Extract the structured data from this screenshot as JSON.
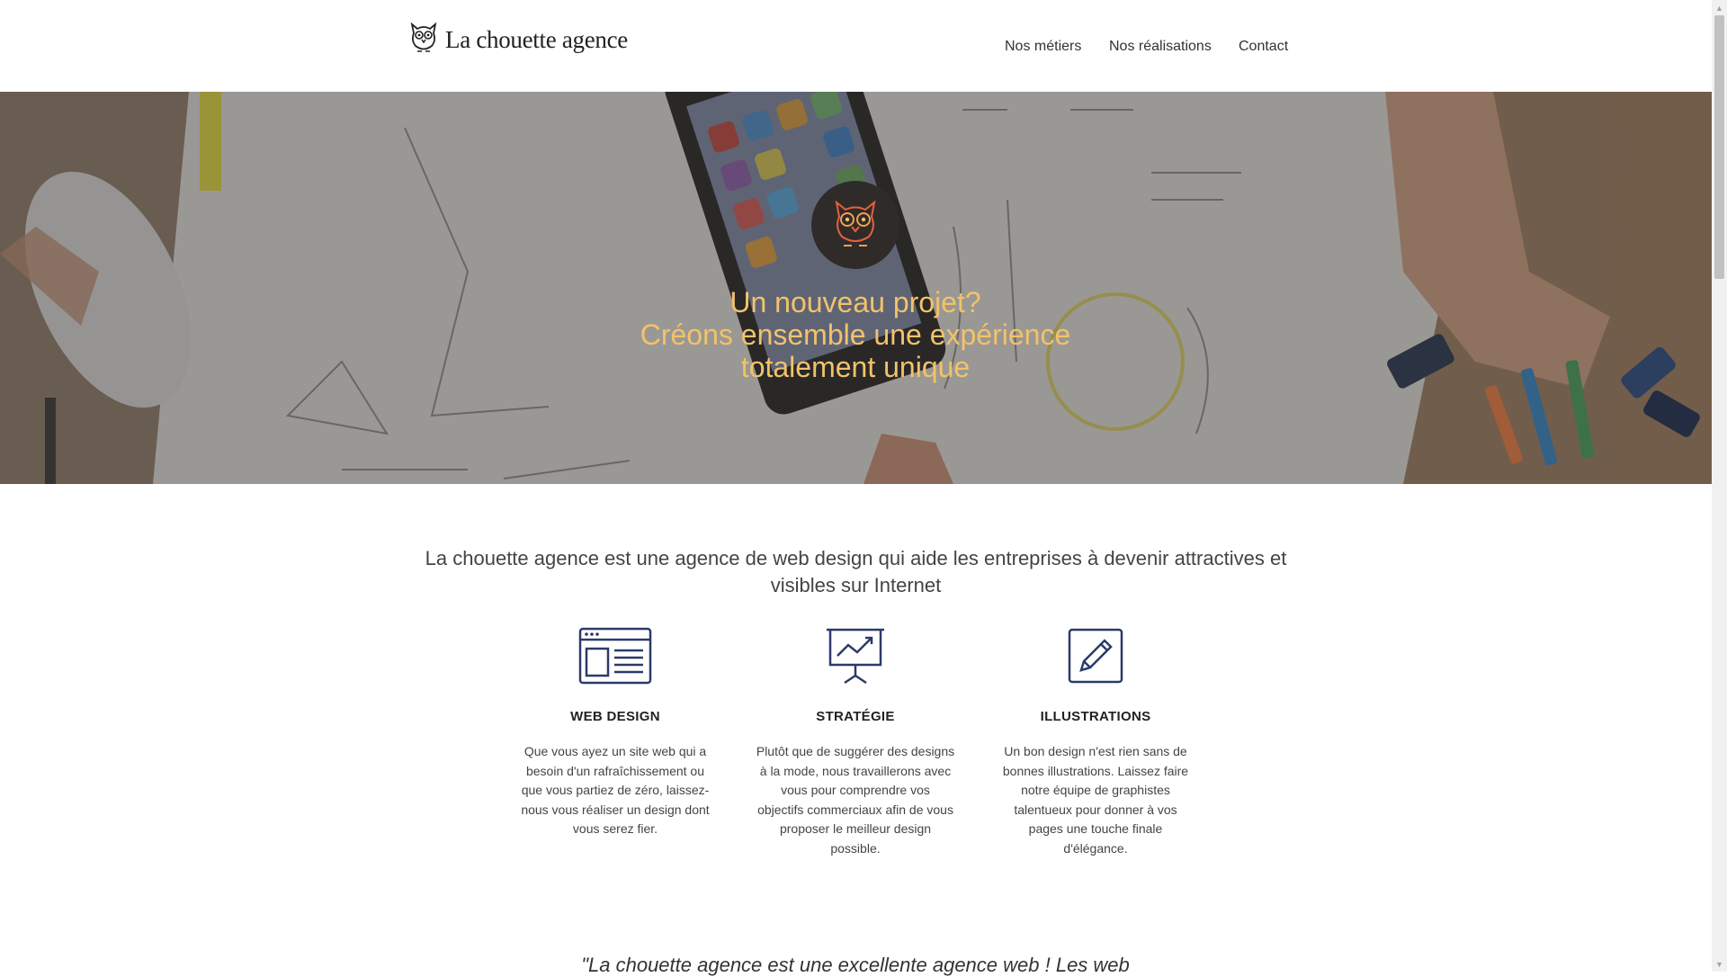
{
  "brand": {
    "name": "La chouette agence",
    "logo_icon": "owl-icon"
  },
  "nav": {
    "items": [
      "Nos métiers",
      "Nos réalisations",
      "Contact"
    ]
  },
  "hero": {
    "badge_icon": "owl-icon",
    "title_lines": [
      "Un nouveau projet?",
      "Créons ensemble une expérience",
      "totalement unique"
    ],
    "title_color": "#f2c26b"
  },
  "intro": {
    "text_lines": [
      "La chouette agence est une agence de web design qui aide les entreprises à devenir attractives et",
      "visibles sur Internet"
    ]
  },
  "services": [
    {
      "icon": "web-design-icon",
      "title": "WEB DESIGN",
      "lines": [
        "Que vous ayez un site web qui a",
        "besoin d'un rafraîchissement ou",
        "que vous partiez de zéro, laissez-",
        "nous vous réaliser un design dont",
        "vous serez fier."
      ]
    },
    {
      "icon": "strategy-presentation-icon",
      "title": "STRATÉGIE",
      "lines": [
        "Plutôt que de suggérer des designs",
        "à la mode, nous travaillerons avec",
        "vous pour comprendre vos",
        "objectifs commerciaux afin de vous",
        "proposer le meilleur design",
        "possible."
      ]
    },
    {
      "icon": "pencil-icon",
      "title": "ILLUSTRATIONS",
      "lines": [
        "Un bon design n'est rien sans de",
        "bonnes illustrations. Laissez faire",
        "notre équipe de graphistes",
        "talentueux pour donner à vos",
        "pages une touche finale",
        "d'élégance."
      ]
    }
  ],
  "quote": {
    "text": "\"La chouette agence est une excellente agence web ! Les web"
  },
  "colors": {
    "icon_navy": "#2c3a6a",
    "accent": "#f2c26b"
  }
}
